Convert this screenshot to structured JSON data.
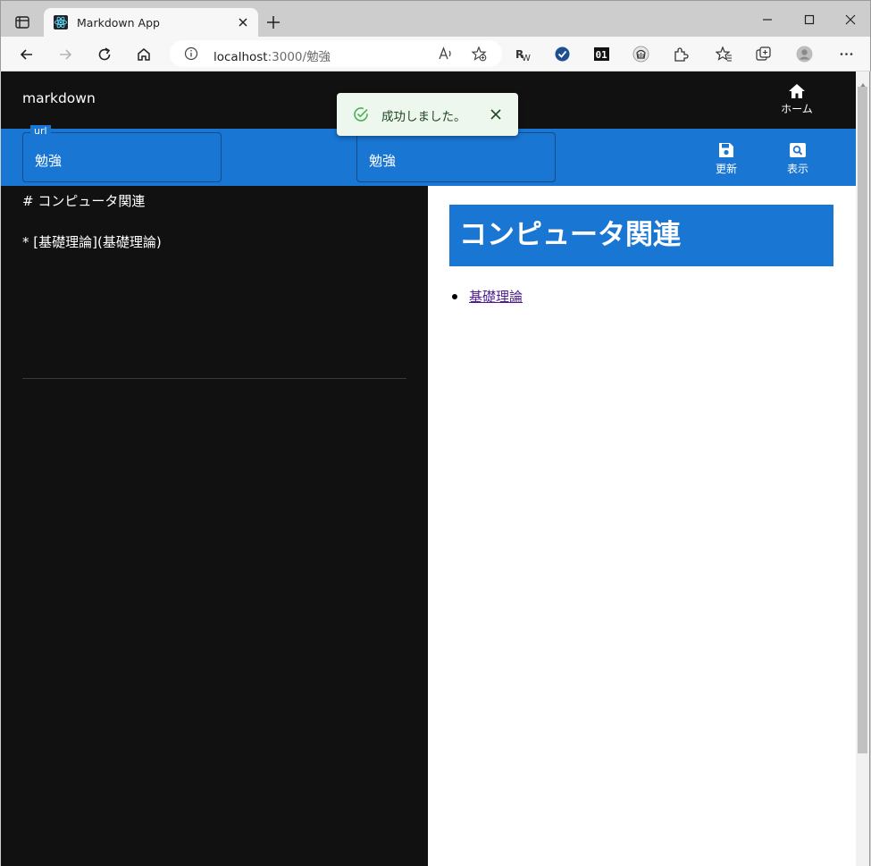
{
  "browser": {
    "tab_title": "Markdown App",
    "url_host": "localhost",
    "url_path": ":3000/勉強"
  },
  "app": {
    "title": "markdown",
    "home_label": "ホーム"
  },
  "toolbar": {
    "url_field_label": "url",
    "url_field_value": "勉強",
    "name_field_value": "勉強",
    "update_label": "更新",
    "view_label": "表示"
  },
  "editor": {
    "content": "# コンピュータ関連\n\n* [基礎理論](基礎理論)"
  },
  "preview": {
    "heading": "コンピュータ関連",
    "items": [
      {
        "label": "基礎理論"
      }
    ]
  },
  "snackbar": {
    "message": "成功しました。"
  },
  "colors": {
    "primary": "#1976d2",
    "app_background": "#111111",
    "success_bg": "#edf7ed",
    "success_icon": "#4caf50"
  },
  "icons": [
    "tab-actions-icon",
    "react-favicon-icon",
    "close-icon",
    "plus-icon",
    "minimize-icon",
    "maximize-icon",
    "back-arrow-icon",
    "forward-arrow-icon",
    "refresh-icon",
    "home-icon",
    "info-icon",
    "read-aloud-icon",
    "favorite-add-icon",
    "extension-icon",
    "favorites-icon",
    "collections-icon",
    "profile-icon",
    "more-icon",
    "save-icon",
    "search-icon",
    "check-circle-icon"
  ]
}
